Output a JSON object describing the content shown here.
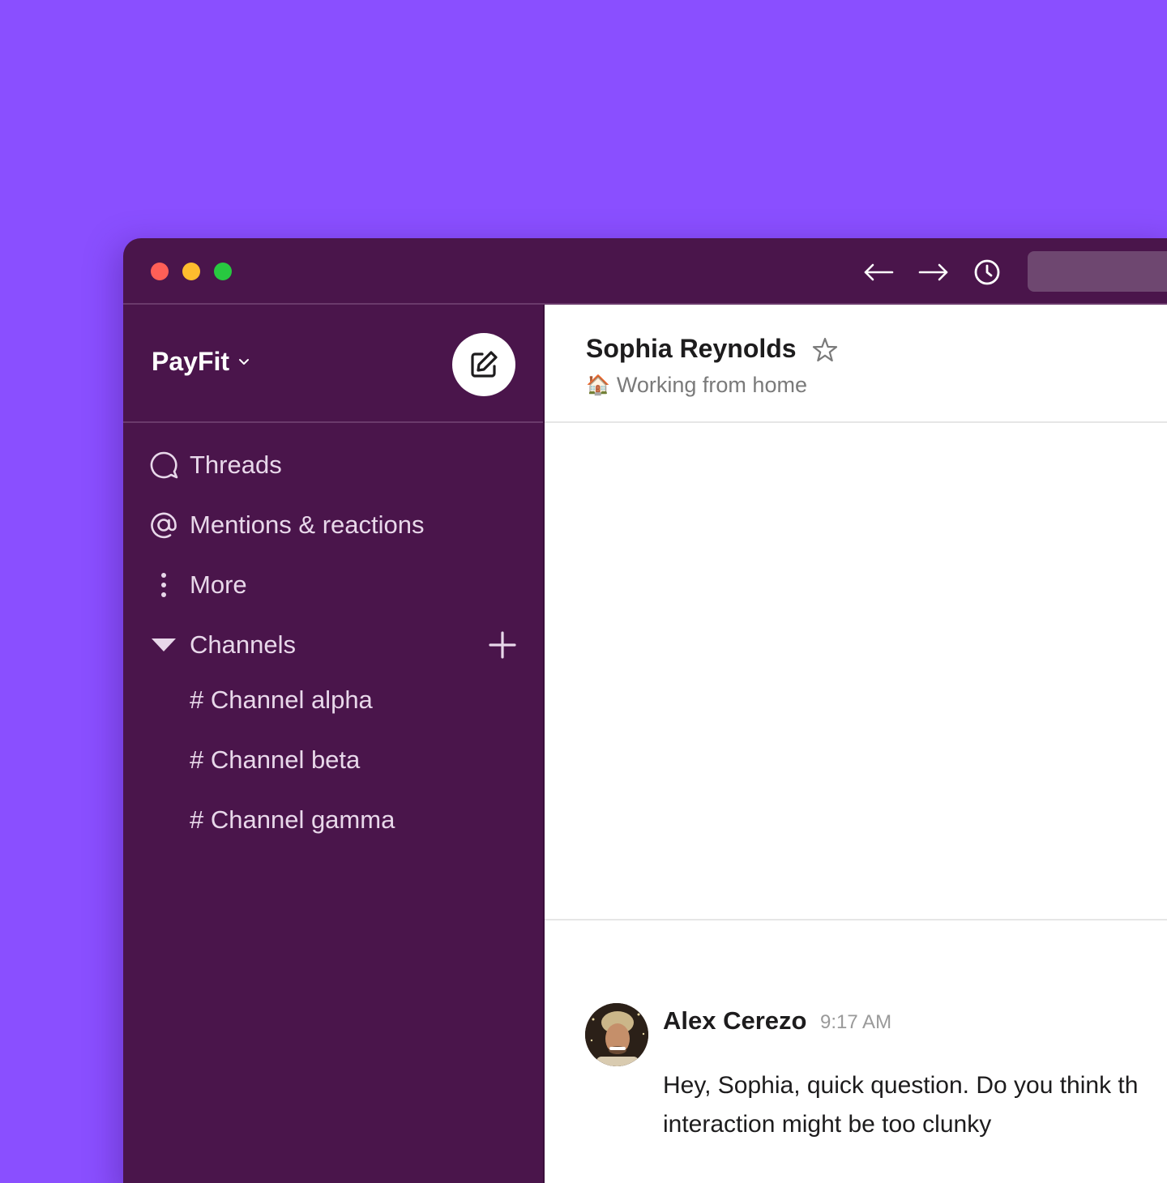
{
  "colors": {
    "backdrop": "#8a4fff",
    "sidebar": "#4a154b",
    "sidebar_text": "#e8d8ea",
    "main_bg": "#ffffff"
  },
  "titlebar": {
    "icons": [
      "arrow-left-icon",
      "arrow-right-icon",
      "history-icon"
    ]
  },
  "sidebar": {
    "workspace_name": "PayFit",
    "nav": [
      {
        "icon": "threads-icon",
        "label": "Threads"
      },
      {
        "icon": "at-icon",
        "label": "Mentions & reactions"
      },
      {
        "icon": "more-vertical-icon",
        "label": "More"
      }
    ],
    "channels_section": {
      "icon": "caret-down-icon",
      "label": "Channels"
    },
    "channels": [
      "# Channel alpha",
      "# Channel beta",
      "# Channel gamma"
    ]
  },
  "conversation": {
    "name": "Sophia Reynolds",
    "status_emoji": "🏠",
    "status_text": "Working from home"
  },
  "message": {
    "author": "Alex Cerezo",
    "time": "9:17 AM",
    "text_line1": "Hey, Sophia, quick question. Do you think th",
    "text_line2": "interaction might be too clunky"
  }
}
